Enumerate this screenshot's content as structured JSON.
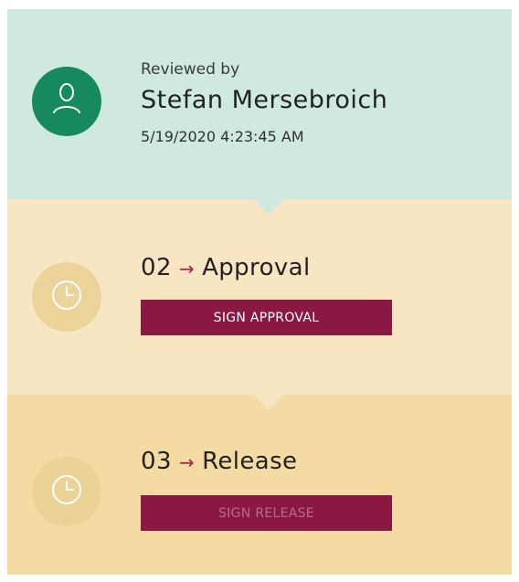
{
  "header": {
    "heading_fragment": ""
  },
  "review": {
    "label": "Reviewed by",
    "name": "Stefan Mersebroich",
    "timestamp": "5/19/2020 4:23:45 AM",
    "avatar_icon": "user-icon",
    "color": "#cfe9e1",
    "avatar_color": "#168a5d"
  },
  "steps": [
    {
      "number": "02",
      "arrow": "→",
      "title": "Approval",
      "button_label": "SIGN APPROVAL",
      "button_enabled": true,
      "icon": "clock-icon",
      "color": "#f8e6c3"
    },
    {
      "number": "03",
      "arrow": "→",
      "title": "Release",
      "button_label": "SIGN RELEASE",
      "button_enabled": false,
      "icon": "clock-icon",
      "color": "#f4dba3"
    }
  ],
  "colors": {
    "accent": "#8b1842",
    "arrow": "#a32445"
  }
}
